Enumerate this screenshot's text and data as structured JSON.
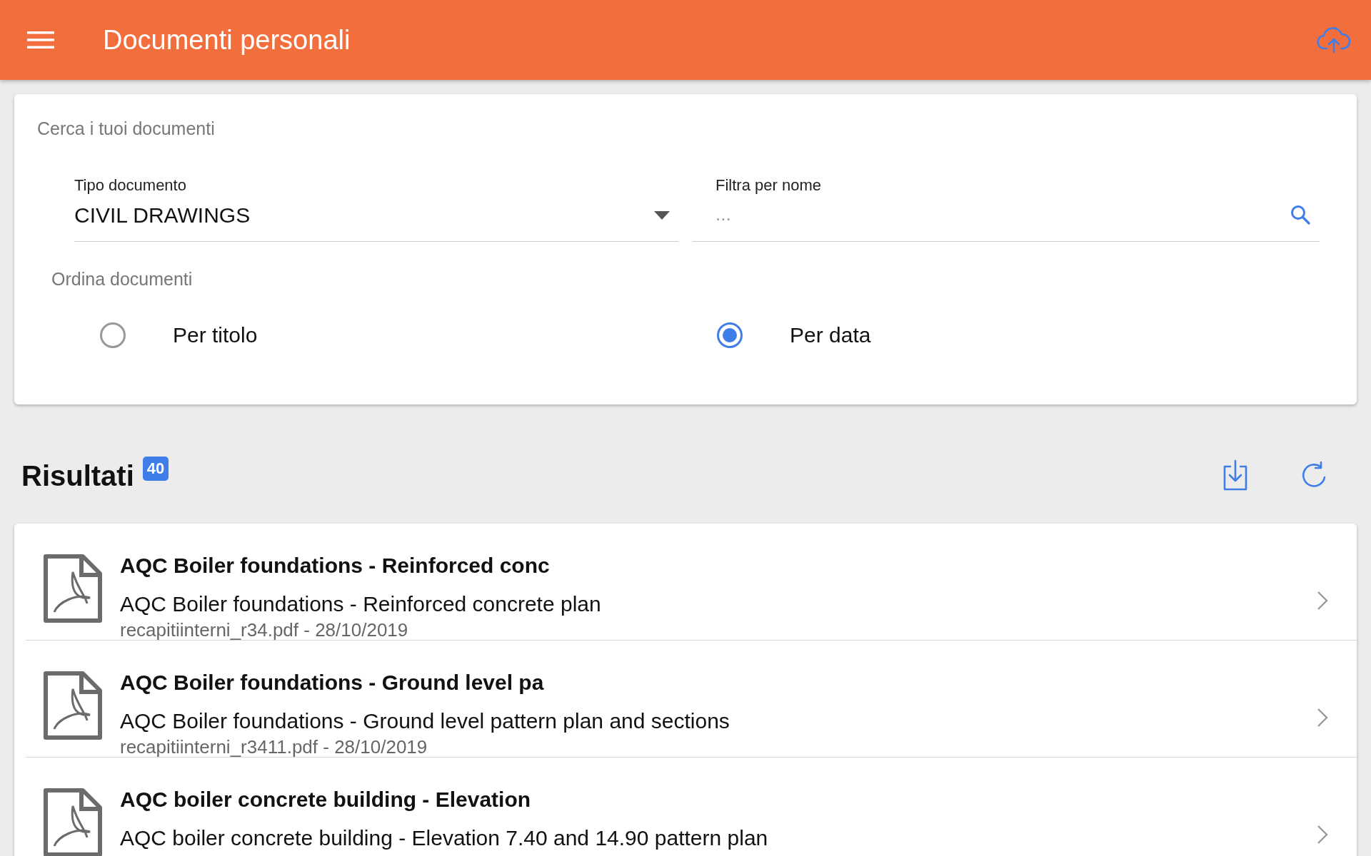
{
  "app_bar": {
    "title": "Documenti personali"
  },
  "search": {
    "heading": "Cerca i tuoi documenti",
    "document_type": {
      "label": "Tipo documento",
      "value": "CIVIL DRAWINGS"
    },
    "name_filter": {
      "label": "Filtra per nome",
      "placeholder": "..."
    },
    "sort": {
      "label": "Ordina documenti",
      "options": [
        {
          "label": "Per titolo",
          "selected": false
        },
        {
          "label": "Per data",
          "selected": true
        }
      ]
    }
  },
  "results": {
    "title": "Risultati",
    "count": "40",
    "items": [
      {
        "title": "AQC Boiler foundations - Reinforced conc",
        "description": "AQC Boiler foundations - Reinforced concrete plan",
        "meta": "recapitiinterni_r34.pdf - 28/10/2019"
      },
      {
        "title": "AQC Boiler foundations - Ground level pa",
        "description": "AQC Boiler foundations - Ground level pattern plan and sections",
        "meta": "recapitiinterni_r3411.pdf - 28/10/2019"
      },
      {
        "title": "AQC boiler concrete building - Elevation",
        "description": "AQC boiler concrete building - Elevation 7.40 and 14.90 pattern plan"
      }
    ]
  }
}
